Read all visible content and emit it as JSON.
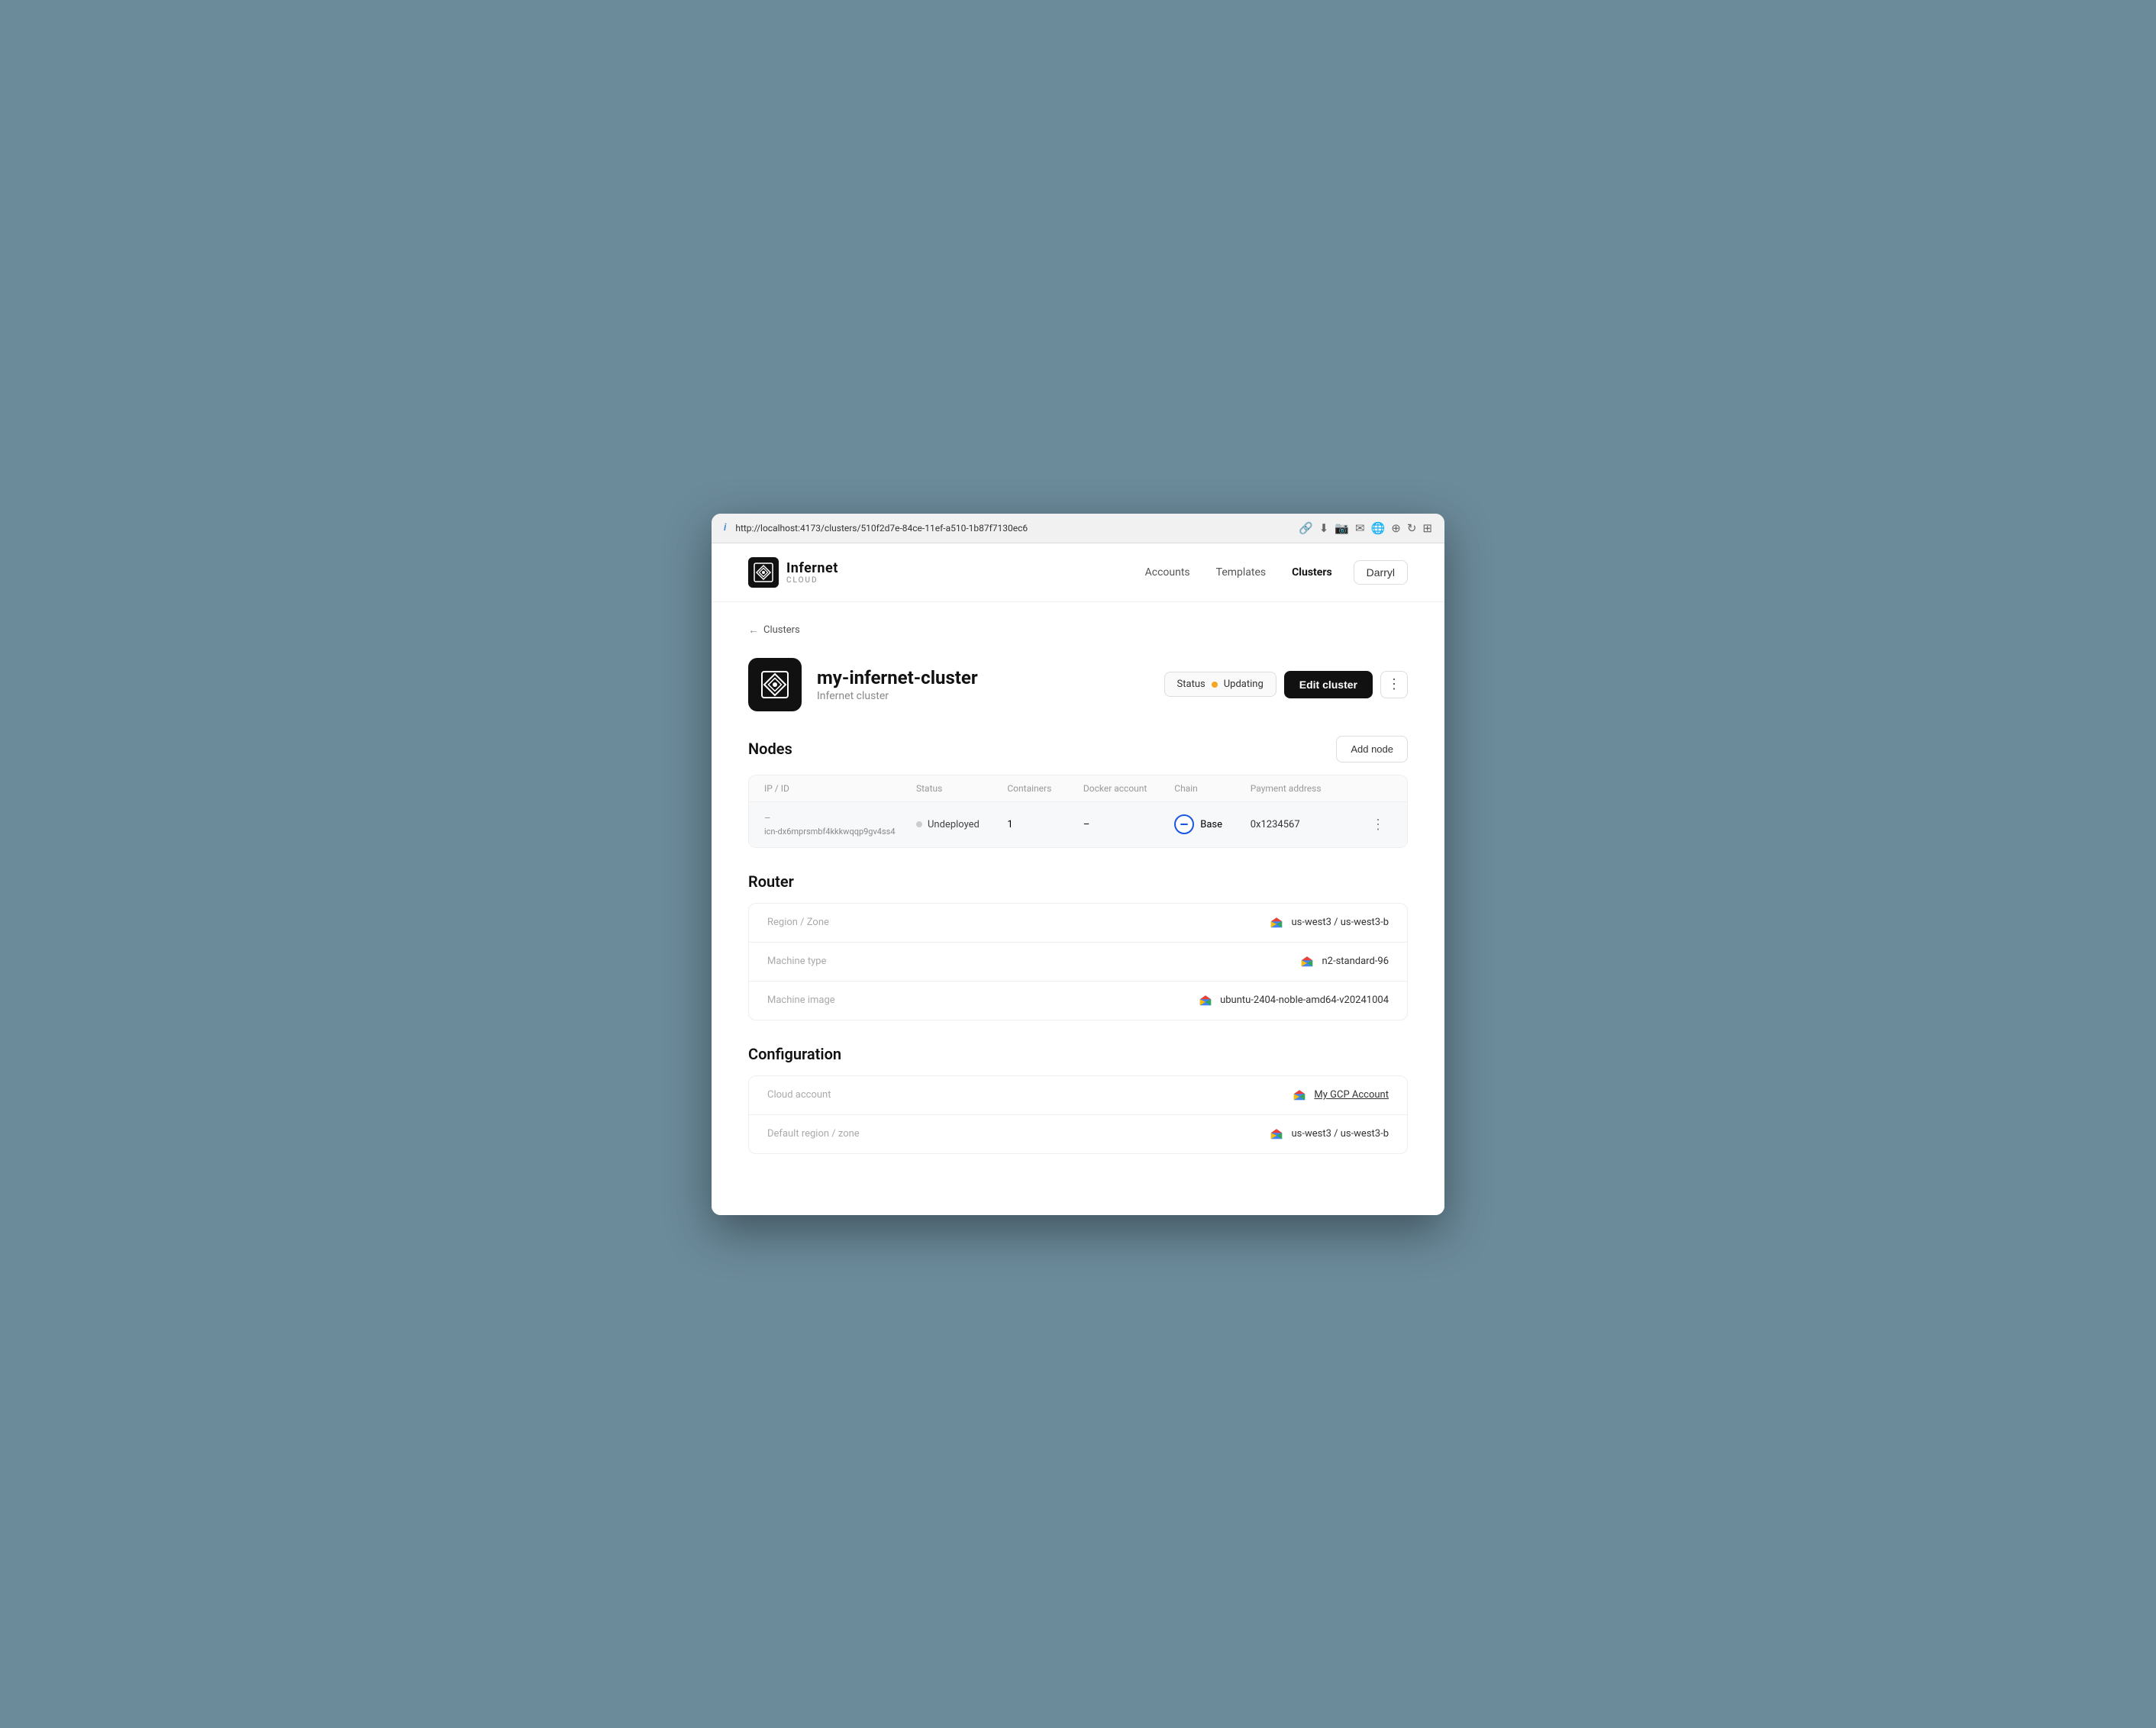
{
  "browser": {
    "url": "http://localhost:4173/clusters/510f2d7e-84ce-11ef-a510-1b87f7130ec6",
    "info_icon": "i"
  },
  "nav": {
    "logo_name": "Infernet",
    "logo_sub": "CLOUD",
    "links": [
      {
        "id": "accounts",
        "label": "Accounts",
        "active": false
      },
      {
        "id": "templates",
        "label": "Templates",
        "active": false
      },
      {
        "id": "clusters",
        "label": "Clusters",
        "active": true
      }
    ],
    "user_label": "Darryl"
  },
  "breadcrumb": {
    "arrow": "←",
    "label": "Clusters"
  },
  "cluster": {
    "name": "my-infernet-cluster",
    "subtitle": "Infernet cluster",
    "status_label": "Status",
    "status_value": "Updating",
    "edit_label": "Edit cluster"
  },
  "nodes": {
    "section_title": "Nodes",
    "add_label": "Add node",
    "columns": [
      "IP / ID",
      "Status",
      "Containers",
      "Docker account",
      "Chain",
      "Payment address",
      ""
    ],
    "rows": [
      {
        "ip": "–",
        "id": "icn-dx6mprsmbf4kkkwqqp9gv4ss4",
        "status": "Undeployed",
        "containers": "1",
        "docker_account": "–",
        "chain": "Base",
        "payment_address": "0x1234567"
      }
    ]
  },
  "router": {
    "section_title": "Router",
    "rows": [
      {
        "label": "Region / Zone",
        "value": "us-west3 / us-west3-b",
        "has_gcp": true
      },
      {
        "label": "Machine type",
        "value": "n2-standard-96",
        "has_gcp": true
      },
      {
        "label": "Machine image",
        "value": "ubuntu-2404-noble-amd64-v20241004",
        "has_gcp": true
      }
    ]
  },
  "configuration": {
    "section_title": "Configuration",
    "rows": [
      {
        "label": "Cloud account",
        "value": "My GCP Account",
        "has_gcp": true,
        "is_link": true
      },
      {
        "label": "Default region / zone",
        "value": "us-west3 / us-west3-b",
        "has_gcp": true
      }
    ]
  }
}
